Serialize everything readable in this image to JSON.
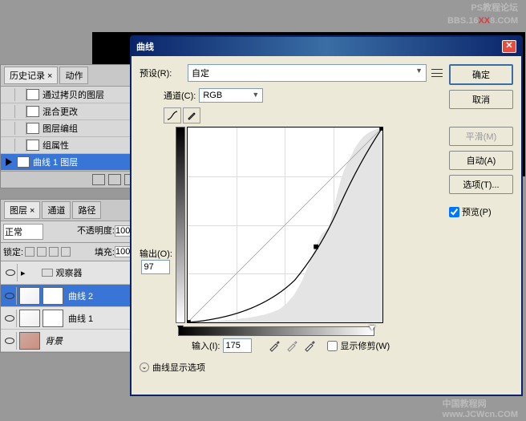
{
  "watermark": {
    "line1": "PS教程论坛",
    "line2a": "BBS.16",
    "line2b": "XX",
    "line2c": "8.COM",
    "bottom1": "中国教程网",
    "bottom2": "www.JCWcn.COM"
  },
  "history": {
    "tab1": "历史记录",
    "tab2": "动作",
    "items": [
      "通过拷贝的图层",
      "混合更改",
      "图层编组",
      "组属性",
      "曲线 1 图层"
    ]
  },
  "layers": {
    "tab1": "图层",
    "tab2": "通道",
    "tab3": "路径",
    "mode": "正常",
    "opacity_label": "不透明度:",
    "opacity": "100",
    "lock_label": "锁定:",
    "fill_label": "填充:",
    "fill": "100",
    "group": "观察器",
    "items": [
      "曲线 2",
      "曲线 1",
      "背景"
    ]
  },
  "dialog": {
    "title": "曲线",
    "preset_label": "预设(R):",
    "preset_value": "自定",
    "channel_label": "通道(C):",
    "channel_value": "RGB",
    "output_label": "输出(O):",
    "output_value": "97",
    "input_label": "输入(I):",
    "input_value": "175",
    "show_clip": "显示修剪(W)",
    "display_options": "曲线显示选项",
    "ok": "确定",
    "cancel": "取消",
    "smooth": "平滑(M)",
    "auto": "自动(A)",
    "options": "选项(T)...",
    "preview": "预览(P)"
  },
  "chart_data": {
    "type": "line",
    "title": "Curves",
    "xlabel": "Input",
    "ylabel": "Output",
    "xlim": [
      0,
      255
    ],
    "ylim": [
      0,
      255
    ],
    "series": [
      {
        "name": "baseline",
        "x": [
          0,
          255
        ],
        "y": [
          0,
          255
        ]
      },
      {
        "name": "curve",
        "x": [
          0,
          64,
          128,
          175,
          220,
          255
        ],
        "y": [
          0,
          15,
          45,
          97,
          175,
          255
        ]
      }
    ],
    "control_point": {
      "input": 175,
      "output": 97
    }
  }
}
